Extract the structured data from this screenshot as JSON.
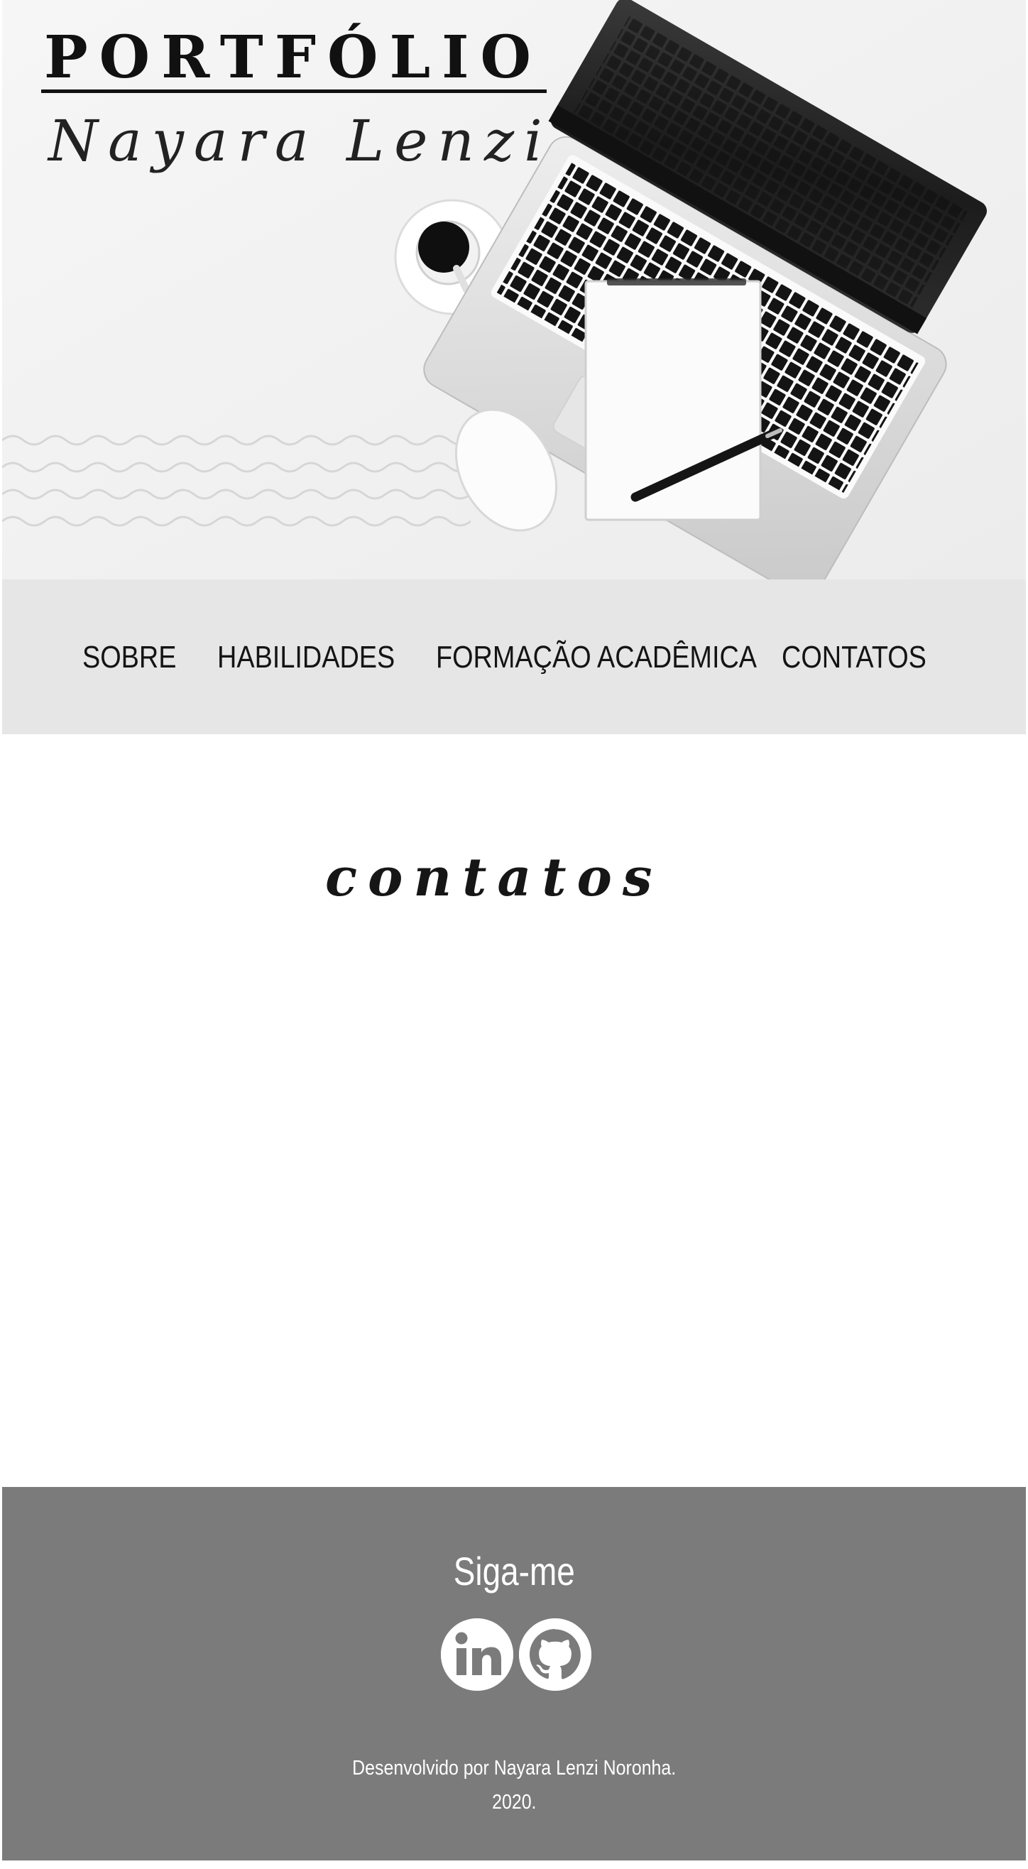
{
  "header": {
    "title": "PORTFÓLIO",
    "signature": "Nayara Lenzi",
    "hero_image": "laptop-coffee-notebook-desk-photo"
  },
  "nav": {
    "items": [
      {
        "label": "SOBRE"
      },
      {
        "label": "HABILIDADES"
      },
      {
        "label": "FORMAÇÃO ACADÊMICA"
      },
      {
        "label": "CONTATOS"
      }
    ]
  },
  "main": {
    "section_title": "contatos"
  },
  "footer": {
    "heading": "Siga-me",
    "social": [
      {
        "icon": "linkedin-icon"
      },
      {
        "icon": "github-icon"
      }
    ],
    "credit": "Desenvolvido por Nayara Lenzi Noronha.",
    "year": "2020."
  },
  "colors": {
    "hero_bg": "#f4f4f4",
    "nav_bg": "#e6e6e6",
    "footer_bg": "#7b7b7b",
    "text_dark": "#141414",
    "text_light": "#ffffff"
  }
}
